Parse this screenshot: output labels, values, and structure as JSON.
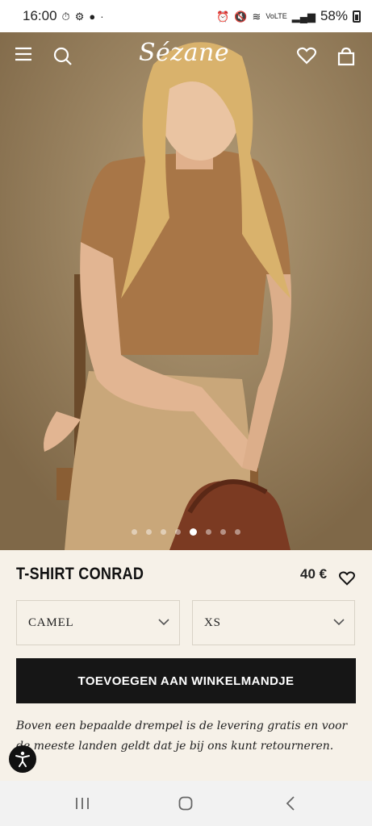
{
  "status_bar": {
    "time": "16:00",
    "left_icons": [
      "timer-icon",
      "gear-icon",
      "chat-icon"
    ],
    "right_icons": [
      "alarm-icon",
      "mute-icon",
      "wifi-icon",
      "volte-icon",
      "signal-icon"
    ],
    "battery": "58%"
  },
  "header": {
    "brand": "Sézane",
    "icons": [
      "menu-icon",
      "search-icon",
      "heart-icon",
      "bag-icon"
    ]
  },
  "carousel": {
    "slide_count": 8,
    "active_index": 4
  },
  "product": {
    "title": "T-SHIRT CONRAD",
    "price": "40 €",
    "color_select": {
      "value": "CAMEL"
    },
    "size_select": {
      "value": "XS"
    },
    "add_to_cart_label": "TOEVOEGEN AAN WINKELMANDJE",
    "shipping_note": "Boven een bepaalde drempel is de levering gratis en voor de meeste landen geldt dat je bij ons kunt retourneren."
  },
  "colors": {
    "cta_background": "#161616",
    "page_background": "#f6f1e8",
    "hero_background": "#9c8560"
  }
}
